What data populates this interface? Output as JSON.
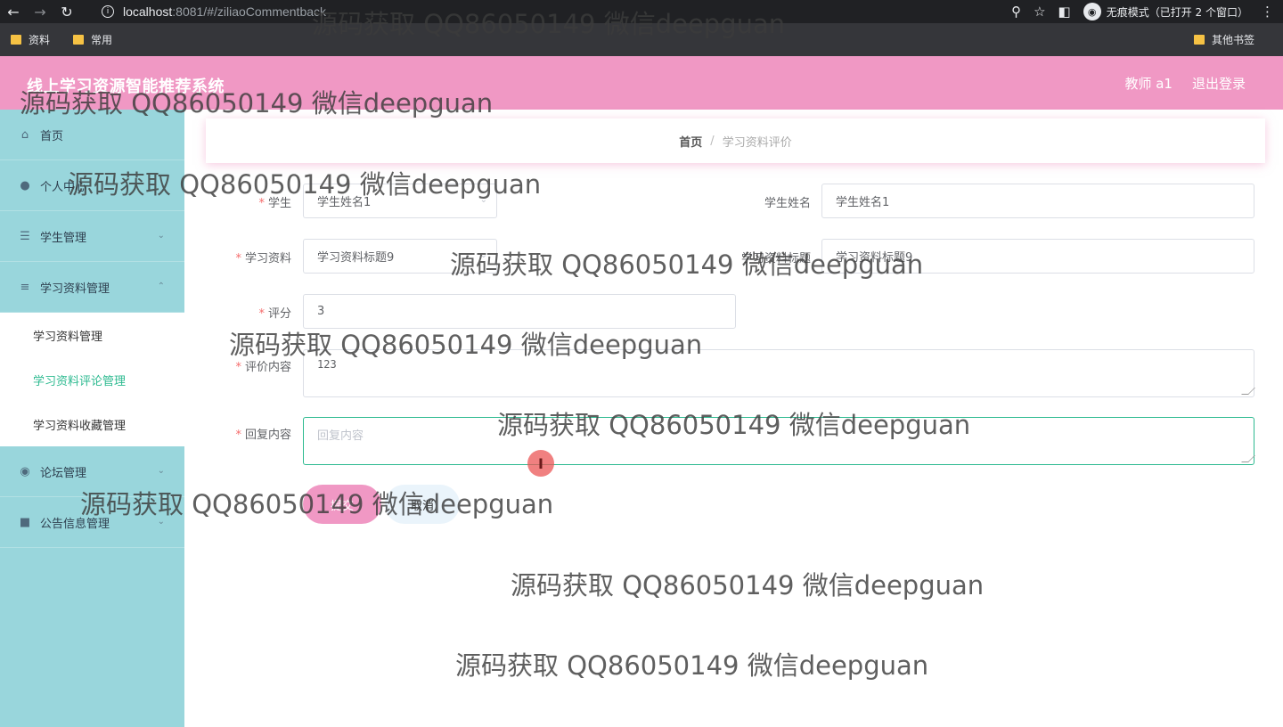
{
  "browser": {
    "url_host": "localhost",
    "url_rest": ":8081/#/ziliaoCommentback",
    "incognito_label": "无痕模式（已打开 2 个窗口）",
    "bookmarks": [
      "资料",
      "常用"
    ],
    "bookmarks_right": "其他书签"
  },
  "header": {
    "title": "线上学习资源智能推荐系统",
    "user": "教师 a1",
    "logout": "退出登录"
  },
  "sidebar": {
    "items": [
      {
        "label": "首页",
        "icon": "home-icon"
      },
      {
        "label": "个人中心",
        "icon": "user-icon"
      },
      {
        "label": "学生管理",
        "icon": "list-icon"
      },
      {
        "label": "学习资料管理",
        "icon": "sliders-icon"
      },
      {
        "label": "论坛管理",
        "icon": "bulb-icon"
      },
      {
        "label": "公告信息管理",
        "icon": "board-icon"
      }
    ],
    "submenu": [
      "学习资料管理",
      "学习资料评论管理",
      "学习资料收藏管理"
    ]
  },
  "breadcrumb": {
    "home": "首页",
    "separator": "/",
    "current": "学习资料评价"
  },
  "form": {
    "student_label": "学生",
    "student_value": "学生姓名1",
    "student_name_label": "学生姓名",
    "student_name_value": "学生姓名1",
    "material_label": "学习资料",
    "material_value": "学习资料标题9",
    "material_title_label": "学习资料标题",
    "material_title_value": "学习资料标题9",
    "score_label": "评分",
    "score_value": "3",
    "comment_label": "评价内容",
    "comment_value": "123",
    "reply_label": "回复内容",
    "reply_placeholder": "回复内容",
    "submit": "提交",
    "cancel": "取消"
  },
  "watermark": "源码获取 QQ86050149 微信deepguan"
}
